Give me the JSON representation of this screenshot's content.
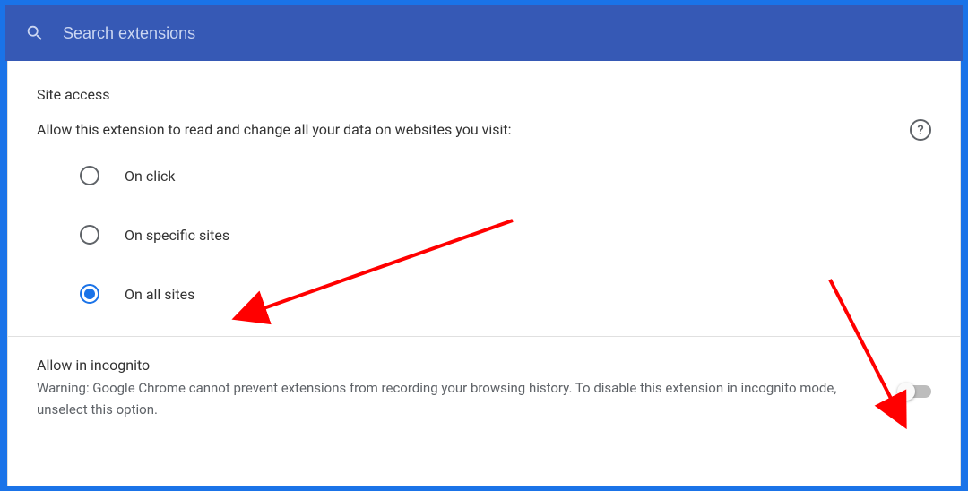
{
  "search": {
    "placeholder": "Search extensions"
  },
  "siteAccess": {
    "title": "Site access",
    "description": "Allow this extension to read and change all your data on websites you visit:",
    "options": [
      {
        "label": "On click",
        "selected": false
      },
      {
        "label": "On specific sites",
        "selected": false
      },
      {
        "label": "On all sites",
        "selected": true
      }
    ]
  },
  "incognito": {
    "title": "Allow in incognito",
    "warning": "Warning: Google Chrome cannot prevent extensions from recording your browsing history. To disable this extension in incognito mode, unselect this option.",
    "enabled": false
  }
}
